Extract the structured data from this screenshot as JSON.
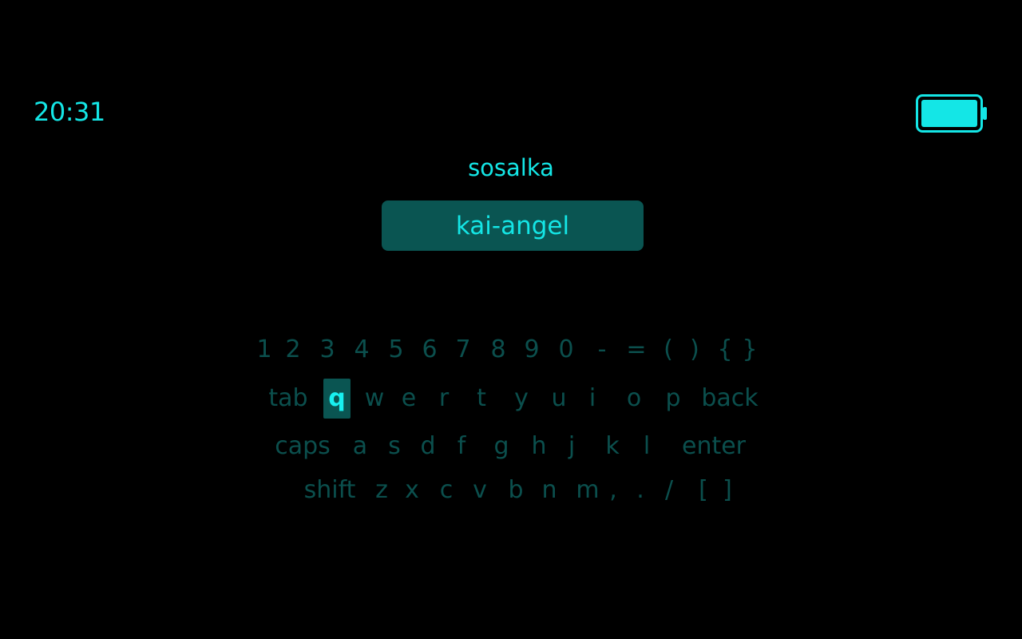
{
  "status": {
    "time": "20:31",
    "battery_icon": "battery-full-icon",
    "accent_color": "#14e6e6"
  },
  "title": "sosalka",
  "input": {
    "value": "kai-angel"
  },
  "keyboard": {
    "selected_key": "q",
    "key_color": "#0b4f4d",
    "selected_bg": "#0a5552",
    "rows": [
      [
        "1",
        "2",
        "3",
        "4",
        "5",
        "6",
        "7",
        "8",
        "9",
        "0",
        "-",
        "=",
        "(",
        ")",
        "{",
        "}"
      ],
      [
        "tab",
        "q",
        "w",
        "e",
        "r",
        "t",
        "y",
        "u",
        "i",
        "o",
        "p",
        "back"
      ],
      [
        "caps",
        "a",
        "s",
        "d",
        "f",
        "g",
        "h",
        "j",
        "k",
        "l",
        "enter"
      ],
      [
        "shift",
        "z",
        "x",
        "c",
        "v",
        "b",
        "n",
        "m",
        ",",
        ".",
        "/",
        "[",
        "]"
      ]
    ]
  }
}
